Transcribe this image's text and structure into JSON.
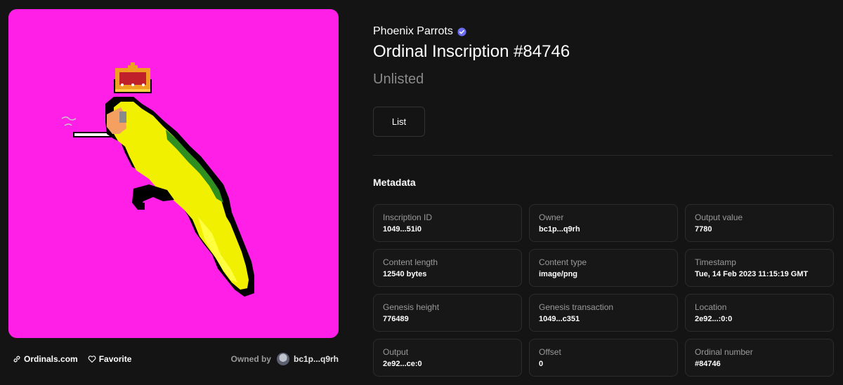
{
  "art": {
    "background": "#ff1fe6",
    "colors": {
      "yellow": "#f0f000",
      "yellow_light": "#ffff40",
      "green": "#2f8f1f",
      "black": "#000000",
      "beak": "#f5a060",
      "eye": "#8a8a8a",
      "crown_gold": "#f0a020",
      "crown_red": "#c0202a",
      "cig": "#ffffff",
      "cig_tip": "#f06a20"
    }
  },
  "footer": {
    "site_label": "Ordinals.com",
    "favorite_label": "Favorite",
    "owned_label": "Owned by",
    "owner_short": "bc1p...q9rh"
  },
  "header": {
    "collection": "Phoenix Parrots",
    "title": "Ordinal Inscription #84746",
    "status": "Unlisted",
    "list_button": "List"
  },
  "metadata": {
    "heading": "Metadata",
    "items": [
      {
        "label": "Inscription ID",
        "value": "1049...51i0"
      },
      {
        "label": "Owner",
        "value": "bc1p...q9rh"
      },
      {
        "label": "Output value",
        "value": "7780"
      },
      {
        "label": "Content length",
        "value": "12540 bytes"
      },
      {
        "label": "Content type",
        "value": "image/png"
      },
      {
        "label": "Timestamp",
        "value": "Tue, 14 Feb 2023 11:15:19 GMT"
      },
      {
        "label": "Genesis height",
        "value": "776489"
      },
      {
        "label": "Genesis transaction",
        "value": "1049...c351"
      },
      {
        "label": "Location",
        "value": "2e92...:0:0"
      },
      {
        "label": "Output",
        "value": "2e92...ce:0"
      },
      {
        "label": "Offset",
        "value": "0"
      },
      {
        "label": "Ordinal number",
        "value": "#84746"
      }
    ]
  }
}
